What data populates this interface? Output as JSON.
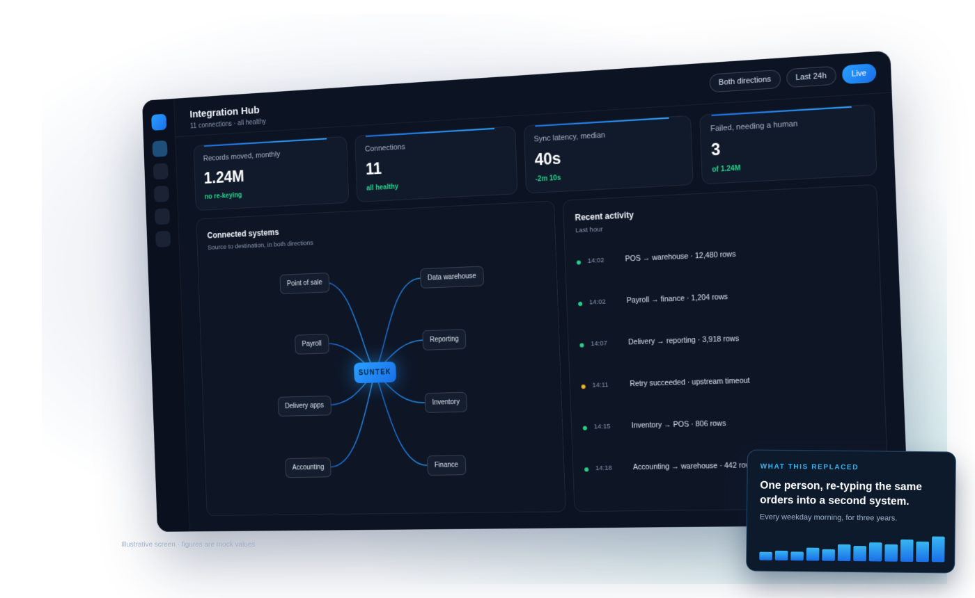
{
  "app": {
    "title": "Integration Hub",
    "subtitle": "11 connections · all healthy"
  },
  "filters": [
    {
      "label": "Both directions"
    },
    {
      "label": "Last 24h"
    },
    {
      "label": "Live"
    }
  ],
  "kpis": [
    {
      "label": "Records moved, monthly",
      "value": "1.24M",
      "note": "no re-keying"
    },
    {
      "label": "Connections",
      "value": "11",
      "note": "all healthy"
    },
    {
      "label": "Sync latency, median",
      "value": "40s",
      "note": "-2m 10s"
    },
    {
      "label": "Failed, needing a human",
      "value": "3",
      "note": "of 1.24M"
    }
  ],
  "systems": {
    "title": "Connected systems",
    "subtitle": "Source to destination, in both directions",
    "hub_label": "SUNTEK",
    "left_nodes": [
      "Point of sale",
      "Payroll",
      "Delivery apps",
      "Accounting"
    ],
    "right_nodes": [
      "Data warehouse",
      "Reporting",
      "Inventory",
      "Finance"
    ]
  },
  "activity": {
    "title": "Recent activity",
    "subtitle": "Last hour",
    "rows": [
      {
        "time": "14:02",
        "text": "POS → warehouse · 12,480 rows",
        "status_color": "#27d18a"
      },
      {
        "time": "14:02",
        "text": "Payroll → finance · 1,204 rows",
        "status_color": "#27d18a"
      },
      {
        "time": "14:07",
        "text": "Delivery → reporting · 3,918 rows",
        "status_color": "#27d18a"
      },
      {
        "time": "14:11",
        "text": "Retry succeeded · upstream timeout",
        "status_color": "#f2b51c"
      },
      {
        "time": "14:15",
        "text": "Inventory → POS · 806 rows",
        "status_color": "#27d18a"
      },
      {
        "time": "14:18",
        "text": "Accounting → warehouse · 442 rows",
        "status_color": "#27d18a"
      }
    ]
  },
  "footnote": "Illustrative screen · figures are mock values",
  "callout": {
    "kicker": "WHAT THIS REPLACED",
    "title": "One person, re-typing the same orders into a second system.",
    "subtitle": "Every weekday morning, for three years.",
    "bar_levels": [
      0.3,
      0.35,
      0.32,
      0.47,
      0.42,
      0.6,
      0.55,
      0.68,
      0.62,
      0.8,
      0.73,
      0.92
    ]
  },
  "colors": {
    "accent": "#2aa0ff",
    "ok": "#27d18a",
    "warn": "#f2b51c",
    "background": "#0c1322"
  }
}
